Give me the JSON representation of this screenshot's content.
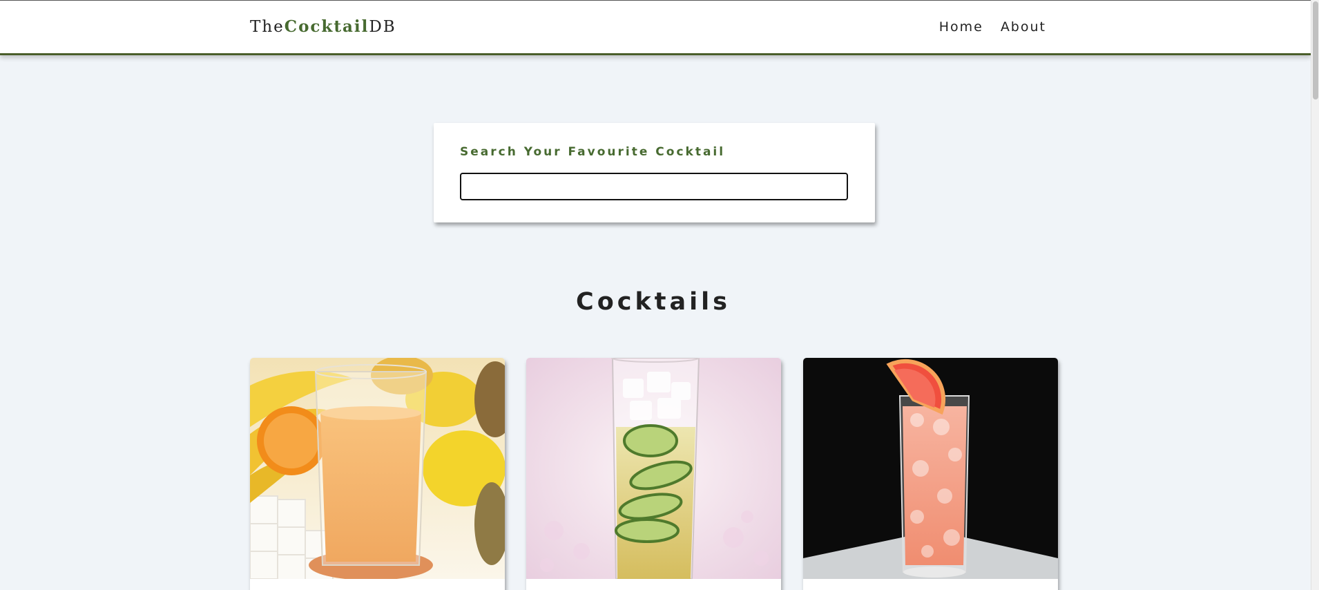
{
  "navbar": {
    "logo": {
      "prefix": "The",
      "brand": "Cocktail",
      "suffix": "DB"
    },
    "links": [
      "Home",
      "About"
    ]
  },
  "search": {
    "label": "Search Your Favourite Cocktail",
    "value": "",
    "placeholder": ""
  },
  "section": {
    "title": "Cocktails"
  },
  "cards": [
    {
      "image": "orange-juice-glass-with-tropical-fruits"
    },
    {
      "image": "cucumber-highball-drink"
    },
    {
      "image": "grapefruit-crushed-ice-cocktail"
    }
  ],
  "colors": {
    "accent": "#476a30",
    "navbar_border": "#4a5e2a",
    "page_background": "#f0f4f8"
  }
}
